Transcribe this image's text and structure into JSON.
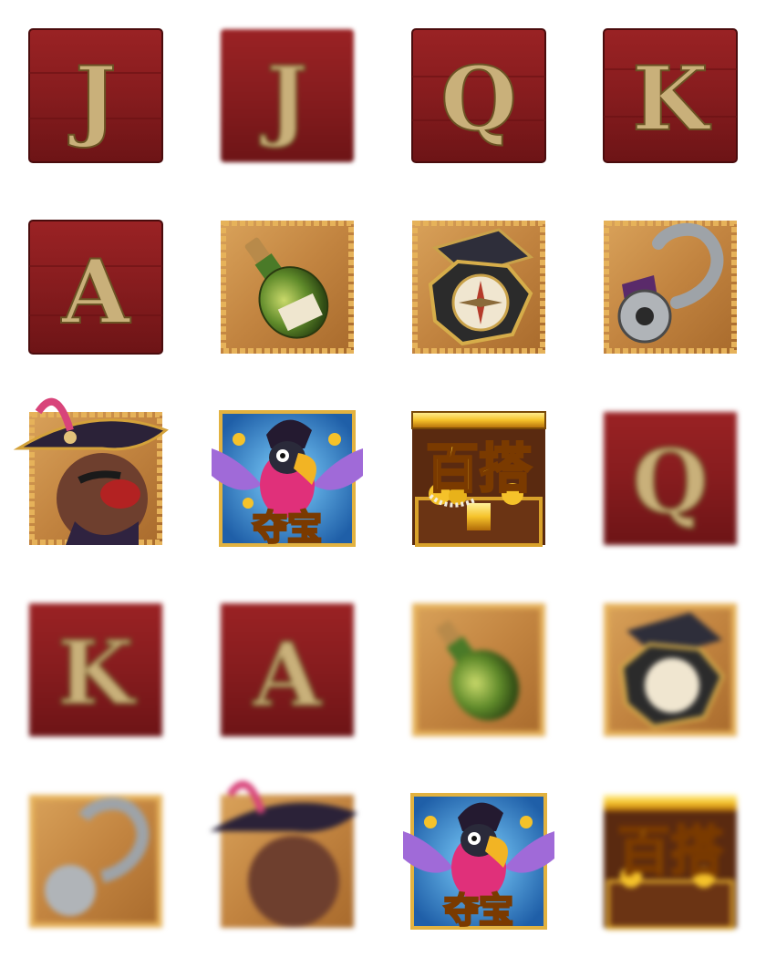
{
  "symbols": {
    "letter_j": "J",
    "letter_q": "Q",
    "letter_k": "K",
    "letter_a": "A",
    "parrot_badge": "夺宝",
    "treasure_badge": "百搭"
  },
  "grid": [
    [
      "J",
      "J (blurred)",
      "Q",
      "K"
    ],
    [
      "A",
      "bottle",
      "compass",
      "hook"
    ],
    [
      "pirate",
      "parrot",
      "treasure",
      "Q (blurred)"
    ],
    [
      "K (blurred)",
      "A (blurred)",
      "bottle (blurred)",
      "compass (blurred)"
    ],
    [
      "hook (blurred)",
      "pirate (blurred)",
      "parrot",
      "treasure (blurred)"
    ]
  ],
  "colors": {
    "wood_red": "#8c1d1e",
    "wood_red_dark": "#5e1012",
    "gold_letter": "#c9b07a",
    "parchment": "#c98f4a",
    "rope": "#d9a24a"
  }
}
